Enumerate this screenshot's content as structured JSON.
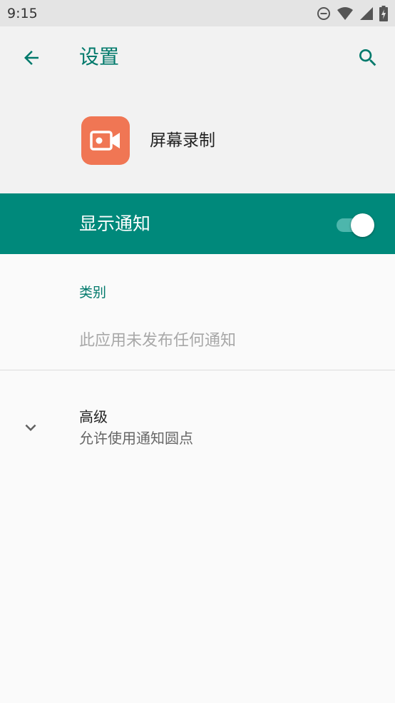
{
  "status_bar": {
    "time": "9:15",
    "icons": [
      "do-not-disturb-icon",
      "wifi-icon",
      "cell-signal-icon",
      "battery-charging-icon"
    ]
  },
  "app_bar": {
    "title": "设置",
    "back_icon": "arrow-left-icon",
    "search_icon": "search-icon"
  },
  "app_header": {
    "app_name": "屏幕录制",
    "icon": "video-camera-icon",
    "icon_color": "#f07654"
  },
  "master_switch": {
    "label": "显示通知",
    "state": "on",
    "background_color": "#00897b"
  },
  "category": {
    "header": "类别",
    "empty_message": "此应用未发布任何通知"
  },
  "advanced": {
    "title": "高级",
    "summary": "允许使用通知圆点",
    "icon": "chevron-down-icon"
  },
  "colors": {
    "accent": "#00796b",
    "status_bar": "#e4e4e4",
    "app_bar": "#f2f2f2"
  }
}
